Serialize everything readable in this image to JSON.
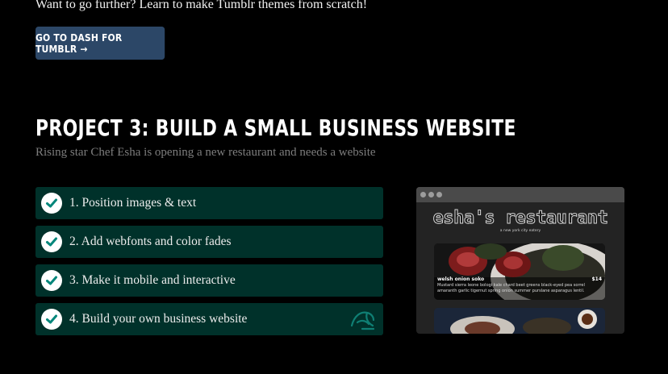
{
  "intro": {
    "text": "Want to go further? Learn to make Tumblr themes from scratch!"
  },
  "dash_button": {
    "label": "GO TO DASH FOR TUMBLR →"
  },
  "project": {
    "title": "PROJECT 3: BUILD A SMALL BUSINESS WEBSITE",
    "subtitle": "Rising star Chef Esha is opening a new restaurant and needs a website"
  },
  "steps": [
    {
      "label": "1. Position images & text",
      "icon": "check-icon"
    },
    {
      "label": "2. Add webfonts and color fades",
      "icon": "check-icon"
    },
    {
      "label": "3. Make it mobile and interactive",
      "icon": "check-icon"
    },
    {
      "label": "4. Build your own business website",
      "icon": "check-icon",
      "badge_icon": "bird-icon"
    }
  ],
  "preview": {
    "restaurant_name": "esha's restaurant",
    "tagline": "a new york city eatery",
    "dish_name": "welsh onion soko",
    "dish_price": "$14",
    "dish_description": "Mustard sierra leone bologi kale chard beet greens black-eyed pea sorrel amaranth garlic tigernut spring onion summer purslane asparagus lentil."
  },
  "colors": {
    "button_bg": "#2c4767",
    "step_bg": "#00312a",
    "check_teal": "#00867a"
  }
}
